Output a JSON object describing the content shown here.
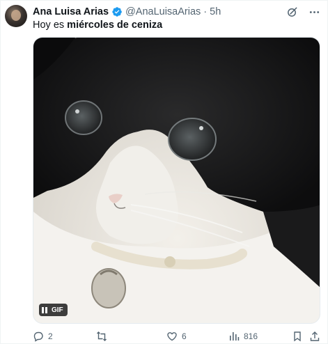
{
  "author": {
    "name": "Ana Luisa Arias",
    "handle": "@AnaLuisaArias",
    "separator": "·",
    "time": "5h"
  },
  "tweet": {
    "text_prefix": "Hoy es ",
    "text_bold": "miércoles de ceniza"
  },
  "media": {
    "badge_label": "GIF"
  },
  "actions": {
    "replies": "2",
    "retweets": "",
    "likes": "6",
    "views": "816"
  },
  "colors": {
    "verified": "#1d9bf0",
    "muted": "#536471"
  },
  "icons": [
    "verified-badge-icon",
    "grok-icon",
    "more-icon",
    "pause-icon",
    "reply-icon",
    "retweet-icon",
    "like-icon",
    "views-icon",
    "bookmark-icon",
    "share-icon"
  ]
}
